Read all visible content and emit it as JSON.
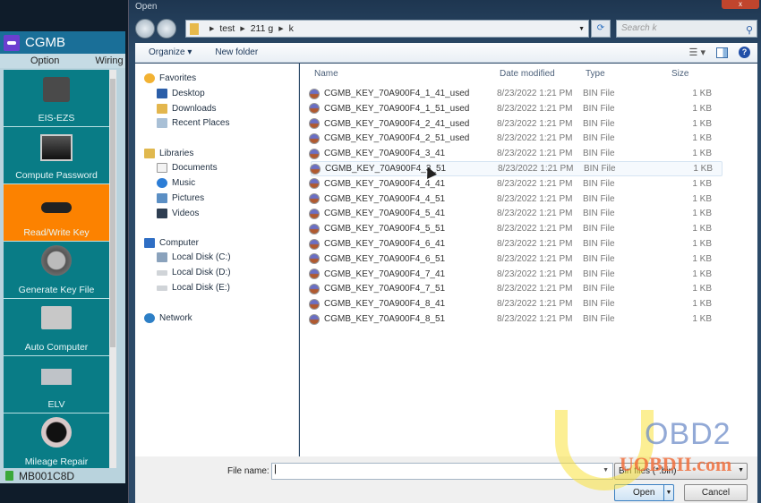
{
  "app": {
    "title": "CGMB",
    "tabs": [
      "Option",
      "Wiring"
    ],
    "items": [
      {
        "label": "EIS-EZS",
        "icon": "ignition-icon",
        "active": false
      },
      {
        "label": "Compute Password",
        "icon": "monitor-icon",
        "active": false
      },
      {
        "label": "Read/Write Key",
        "icon": "car-key-icon",
        "active": true
      },
      {
        "label": "Generate Key File",
        "icon": "printer-icon",
        "active": false
      },
      {
        "label": "Auto Computer",
        "icon": "ecu-icon",
        "active": false
      },
      {
        "label": "ELV",
        "icon": "elv-module-icon",
        "active": false
      },
      {
        "label": "Mileage Repair",
        "icon": "speedometer-icon",
        "active": false
      }
    ],
    "status": "MB001C8D"
  },
  "dialog": {
    "title": "Open",
    "close": "x",
    "breadcrumb": [
      "test",
      "211 g",
      "k"
    ],
    "search_placeholder": "Search k",
    "toolbar": {
      "organize": "Organize ▾",
      "new_folder": "New folder"
    },
    "nav": {
      "favorites": {
        "label": "Favorites",
        "items": [
          "Desktop",
          "Downloads",
          "Recent Places"
        ]
      },
      "libraries": {
        "label": "Libraries",
        "items": [
          "Documents",
          "Music",
          "Pictures",
          "Videos"
        ]
      },
      "computer": {
        "label": "Computer",
        "items": [
          "Local Disk (C:)",
          "Local Disk (D:)",
          "Local Disk (E:)"
        ]
      },
      "network": {
        "label": "Network"
      }
    },
    "columns": [
      "Name",
      "Date modified",
      "Type",
      "Size"
    ],
    "files": [
      {
        "name": "CGMB_KEY_70A900F4_1_41_used",
        "date": "8/23/2022 1:21 PM",
        "type": "BIN File",
        "size": "1 KB"
      },
      {
        "name": "CGMB_KEY_70A900F4_1_51_used",
        "date": "8/23/2022 1:21 PM",
        "type": "BIN File",
        "size": "1 KB"
      },
      {
        "name": "CGMB_KEY_70A900F4_2_41_used",
        "date": "8/23/2022 1:21 PM",
        "type": "BIN File",
        "size": "1 KB"
      },
      {
        "name": "CGMB_KEY_70A900F4_2_51_used",
        "date": "8/23/2022 1:21 PM",
        "type": "BIN File",
        "size": "1 KB"
      },
      {
        "name": "CGMB_KEY_70A900F4_3_41",
        "date": "8/23/2022 1:21 PM",
        "type": "BIN File",
        "size": "1 KB"
      },
      {
        "name": "CGMB_KEY_70A900F4_3_51",
        "date": "8/23/2022 1:21 PM",
        "type": "BIN File",
        "size": "1 KB"
      },
      {
        "name": "CGMB_KEY_70A900F4_4_41",
        "date": "8/23/2022 1:21 PM",
        "type": "BIN File",
        "size": "1 KB"
      },
      {
        "name": "CGMB_KEY_70A900F4_4_51",
        "date": "8/23/2022 1:21 PM",
        "type": "BIN File",
        "size": "1 KB"
      },
      {
        "name": "CGMB_KEY_70A900F4_5_41",
        "date": "8/23/2022 1:21 PM",
        "type": "BIN File",
        "size": "1 KB"
      },
      {
        "name": "CGMB_KEY_70A900F4_5_51",
        "date": "8/23/2022 1:21 PM",
        "type": "BIN File",
        "size": "1 KB"
      },
      {
        "name": "CGMB_KEY_70A900F4_6_41",
        "date": "8/23/2022 1:21 PM",
        "type": "BIN File",
        "size": "1 KB"
      },
      {
        "name": "CGMB_KEY_70A900F4_6_51",
        "date": "8/23/2022 1:21 PM",
        "type": "BIN File",
        "size": "1 KB"
      },
      {
        "name": "CGMB_KEY_70A900F4_7_41",
        "date": "8/23/2022 1:21 PM",
        "type": "BIN File",
        "size": "1 KB"
      },
      {
        "name": "CGMB_KEY_70A900F4_7_51",
        "date": "8/23/2022 1:21 PM",
        "type": "BIN File",
        "size": "1 KB"
      },
      {
        "name": "CGMB_KEY_70A900F4_8_41",
        "date": "8/23/2022 1:21 PM",
        "type": "BIN File",
        "size": "1 KB"
      },
      {
        "name": "CGMB_KEY_70A900F4_8_51",
        "date": "8/23/2022 1:21 PM",
        "type": "BIN File",
        "size": "1 KB"
      }
    ],
    "hovered_file_index": 5,
    "file_name_label": "File name:",
    "file_name_value": "",
    "filter": "Bin files (*.bin)",
    "open_label": "Open",
    "cancel_label": "Cancel"
  },
  "watermark": {
    "brand": "OBD2",
    "site": "UOBDII.com"
  },
  "colors": {
    "app_teal": "#097c86",
    "app_active": "#fc8200",
    "app_header": "#1a6f98"
  }
}
